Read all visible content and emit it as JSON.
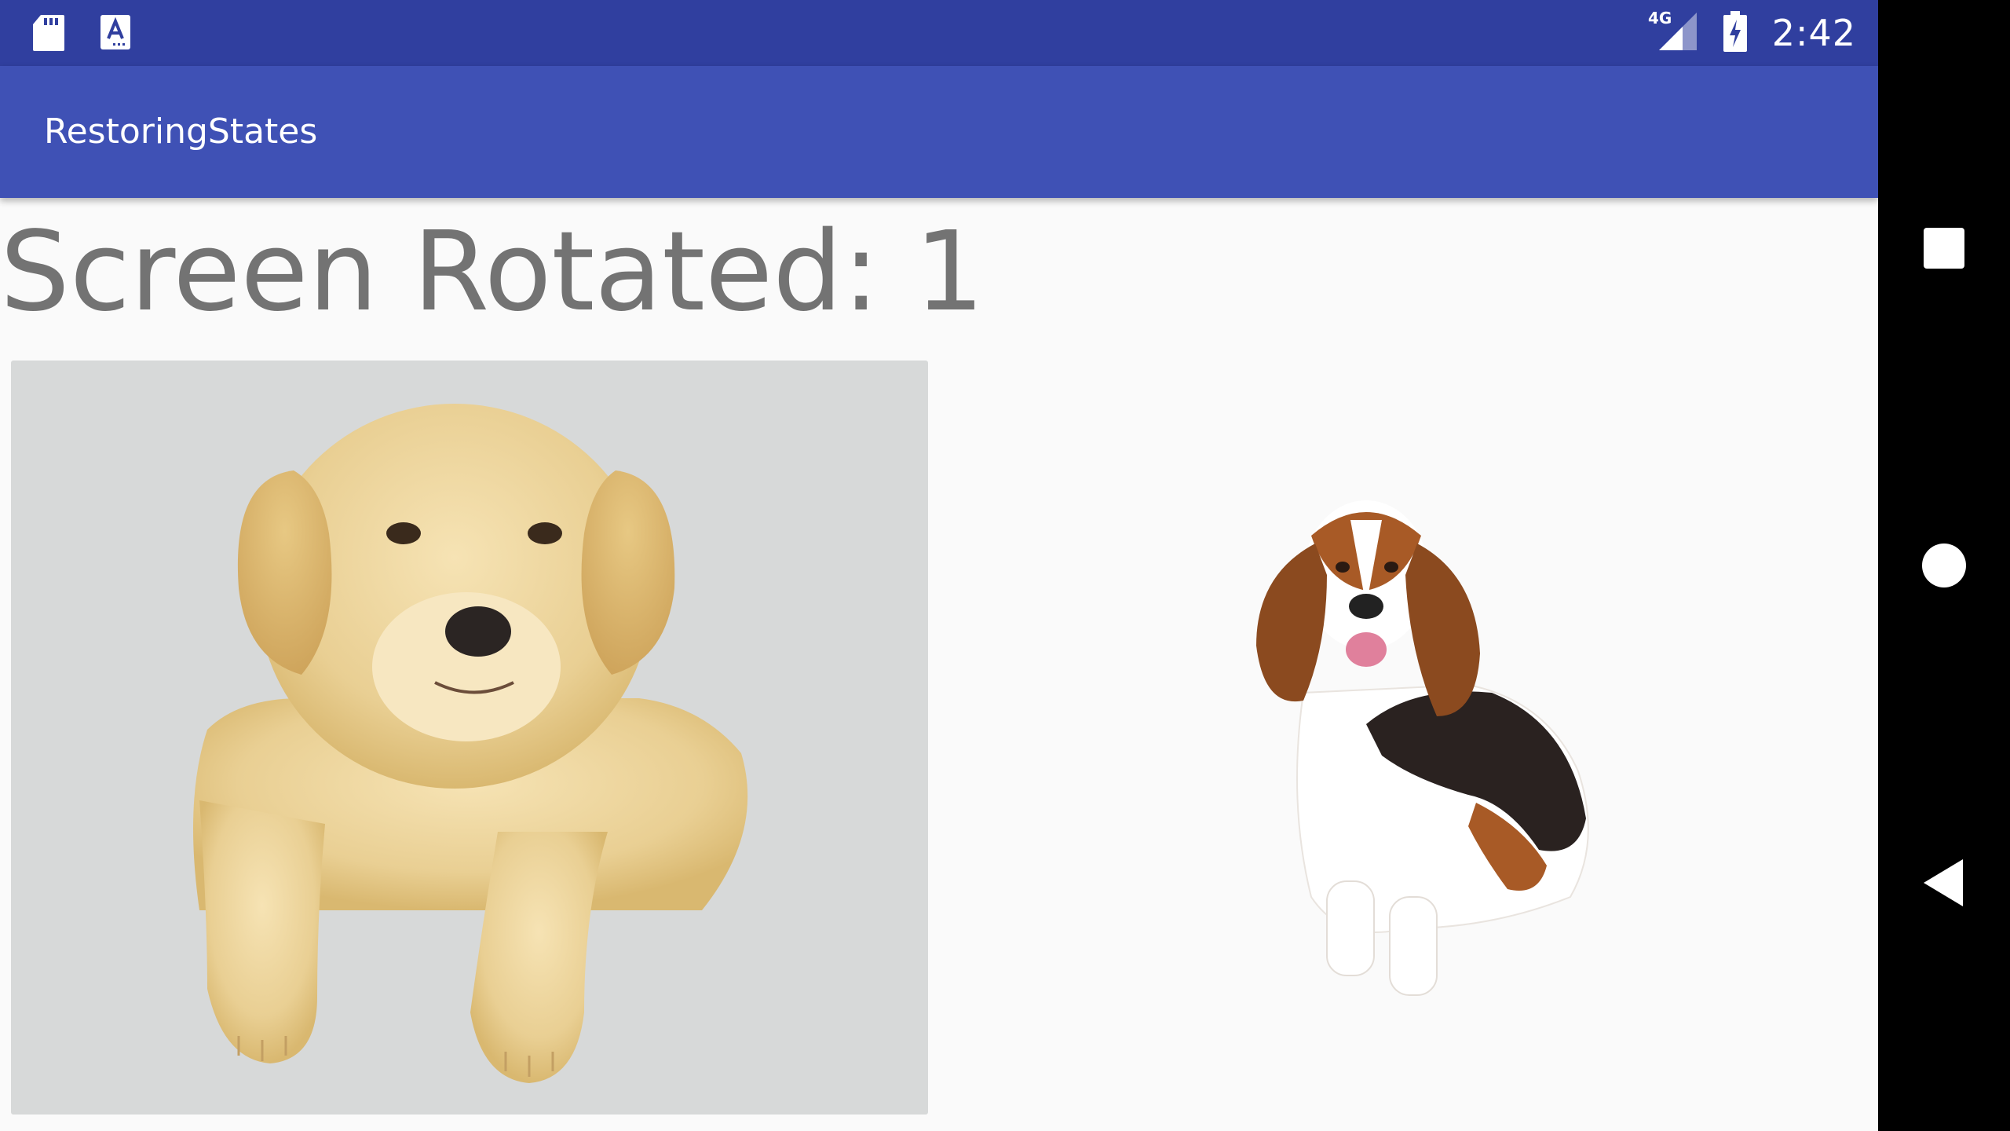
{
  "status_bar": {
    "time": "2:42",
    "network": "4G",
    "left_icons": [
      "sd-card-icon",
      "accessibility-a-icon"
    ],
    "right_icons": [
      "signal-4g-icon",
      "battery-charging-icon"
    ],
    "color": "#303f9f"
  },
  "app_bar": {
    "title": "RestoringStates",
    "color": "#3f51b5"
  },
  "main": {
    "counter_text": "Screen Rotated: 1",
    "images": [
      "golden-retriever-puppy-image",
      "basset-hound-image"
    ]
  },
  "nav_bar": {
    "buttons": [
      "recents-square-icon",
      "home-circle-icon",
      "back-triangle-icon"
    ]
  }
}
